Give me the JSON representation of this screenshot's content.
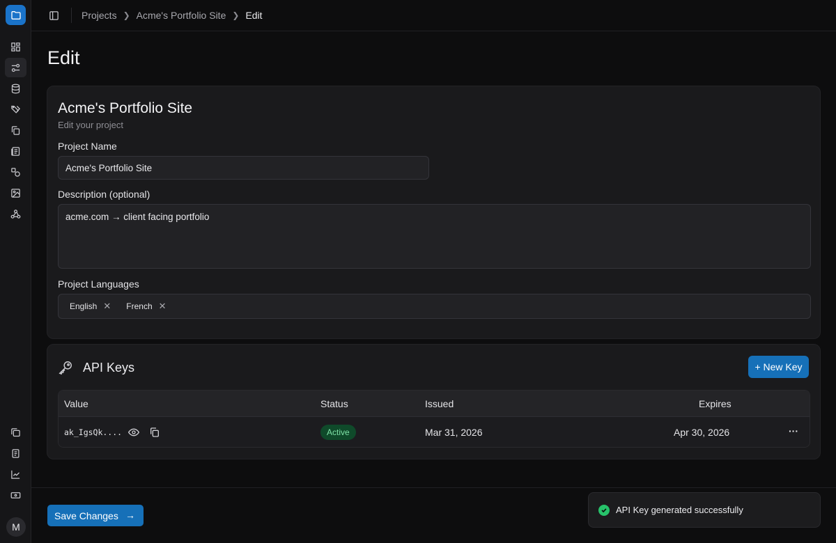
{
  "breadcrumb": [
    "Projects",
    "Acme's Portfolio Site",
    "Edit"
  ],
  "page_title": "Edit",
  "project": {
    "title": "Acme's Portfolio Site",
    "subtitle": "Edit your project",
    "name_label": "Project Name",
    "name_value": "Acme's Portfolio Site",
    "description_label": "Description (optional)",
    "description_value": "acme.com → client facing portfolio",
    "languages_label": "Project Languages",
    "languages": [
      "English",
      "French"
    ]
  },
  "api_keys": {
    "title": "API Keys",
    "new_key_label": "+ New Key",
    "columns": [
      "Value",
      "Status",
      "Issued",
      "Expires"
    ],
    "rows": [
      {
        "value": "ak_IgsQk....",
        "status": "Active",
        "issued": "Mar 31, 2026",
        "expires": "Apr 30, 2026",
        "menu": "···"
      }
    ]
  },
  "save_label": "Save Changes",
  "toast": "API Key generated successfully",
  "avatar_initial": "M",
  "icons": {
    "logo": "folder-icon",
    "sidebar_top": [
      "dashboard-icon",
      "sliders-icon",
      "database-icon",
      "tags-icon",
      "copy-icon",
      "newspaper-icon",
      "shapes-icon",
      "image-icon",
      "webhook-icon"
    ],
    "sidebar_bottom": [
      "files-icon",
      "document-icon",
      "chart-icon",
      "billing-icon"
    ]
  },
  "colors": {
    "accent": "#1670b8",
    "success": "#27c26a",
    "badge_bg": "#0f4a2a"
  }
}
